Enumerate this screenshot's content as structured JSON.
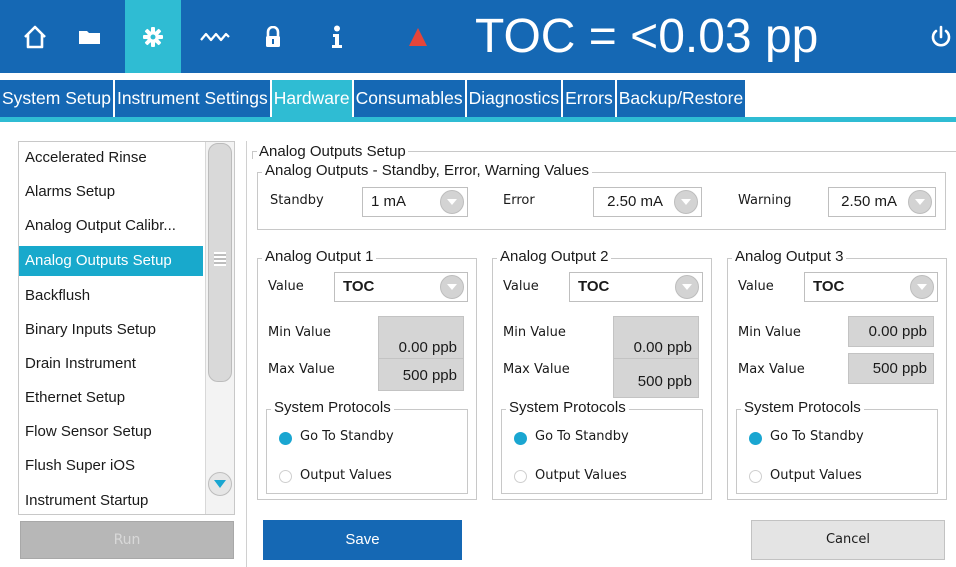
{
  "toolbar": {
    "icons": [
      "home-icon",
      "folder-icon",
      "gear-icon",
      "trend-icon",
      "lock-icon",
      "info-icon",
      "warning-icon",
      "power-icon"
    ],
    "active_icon": "gear-icon",
    "readout": "TOC = <0.03 pp"
  },
  "tabs": [
    {
      "label": "System Setup"
    },
    {
      "label": "Instrument Settings"
    },
    {
      "label": "Hardware"
    },
    {
      "label": "Consumables"
    },
    {
      "label": "Diagnostics"
    },
    {
      "label": "Errors"
    },
    {
      "label": "Backup/Restore"
    }
  ],
  "active_tab": "Hardware",
  "menu": {
    "items": [
      "Accelerated Rinse",
      "Alarms Setup",
      "Analog Output Calibr...",
      "Analog Outputs Setup",
      "Backflush",
      "Binary Inputs Setup",
      "Drain Instrument",
      "Ethernet Setup",
      "Flow Sensor Setup",
      "Flush Super iOS",
      "Instrument Startup"
    ],
    "selected": "Analog Outputs Setup",
    "run_label": "Run"
  },
  "setup": {
    "title": "Analog Outputs Setup",
    "values_group": {
      "legend": "Analog Outputs - Standby, Error, Warning Values",
      "standby_label": "Standby",
      "standby_value": "1 mA",
      "error_label": "Error",
      "error_value": "2.50 mA",
      "warning_label": "Warning",
      "warning_value": "2.50 mA"
    },
    "outputs": [
      {
        "legend": "Analog Output 1",
        "value_label": "Value",
        "value": "TOC",
        "min_label": "Min Value",
        "min_value": "0.00 ppb",
        "max_label": "Max Value",
        "max_value": "500 ppb",
        "protocols_legend": "System Protocols",
        "option_standby": "Go To Standby",
        "option_output": "Output Values",
        "selected_option": "Go To Standby"
      },
      {
        "legend": "Analog Output 2",
        "value_label": "Value",
        "value": "TOC",
        "min_label": "Min Value",
        "min_value": "0.00 ppb",
        "max_label": "Max Value",
        "max_value": "500 ppb",
        "protocols_legend": "System Protocols",
        "option_standby": "Go To Standby",
        "option_output": "Output Values",
        "selected_option": "Go To Standby"
      },
      {
        "legend": "Analog Output 3",
        "value_label": "Value",
        "value": "TOC",
        "min_label": "Min Value",
        "min_value": "0.00 ppb",
        "max_label": "Max Value",
        "max_value": "500 ppb",
        "protocols_legend": "System Protocols",
        "option_standby": "Go To Standby",
        "option_output": "Output Values",
        "selected_option": "Go To Standby"
      }
    ]
  },
  "footer": {
    "save_label": "Save",
    "cancel_label": "Cancel"
  },
  "colors": {
    "primary_blue": "#1568b4",
    "accent_cyan": "#2fbcd3",
    "selection_cyan": "#18a9cc",
    "warning_red": "#e5453a"
  }
}
